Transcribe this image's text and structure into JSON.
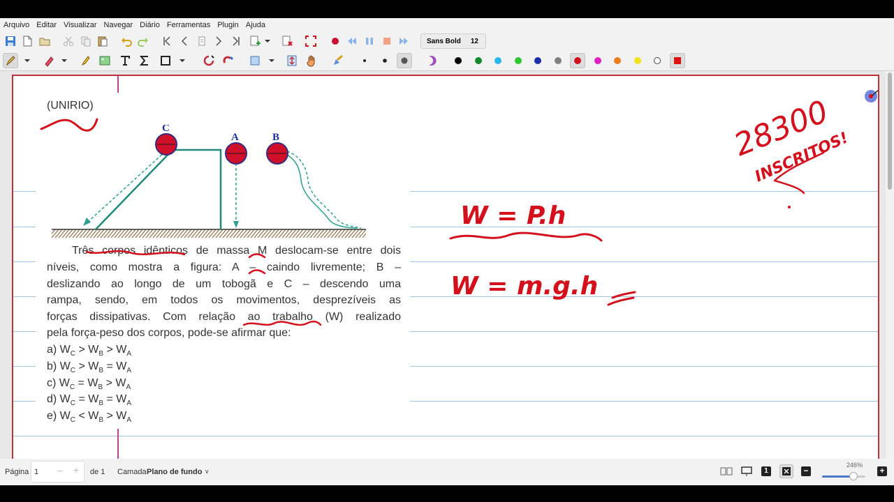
{
  "menu": [
    "Arquivo",
    "Editar",
    "Visualizar",
    "Navegar",
    "Diário",
    "Ferramentas",
    "Plugin",
    "Ajuda"
  ],
  "toolbar": {
    "font_name": "Sans Bold",
    "font_size": "12"
  },
  "pen_colors": [
    "#000000",
    "#138a2e",
    "#27b7e8",
    "#2ec52e",
    "#1a2fa8",
    "#808080",
    "#d0101e",
    "#e020c0",
    "#ee7c1c",
    "#f0e020",
    "#ffffff",
    "#e01010"
  ],
  "document": {
    "source": "(UNIRIO)",
    "labels": {
      "c": "C",
      "a": "A",
      "b": "B"
    },
    "question_lines": [
      "Três corpos idênticos de massa M deslocam-se entre dois",
      "níveis, como mostra a figura: A – caindo livremente; B –",
      "deslizando ao longo de um tobogã e C – descendo uma",
      "rampa, sendo, em todos os movimentos, desprezíveis as",
      "forças dissipativas. Com relação ao trabalho (W) realizado",
      "pela força-peso dos corpos, pode-se afirmar que:"
    ],
    "options": [
      {
        "prefix": "a)",
        "expr": [
          "C",
          " > W",
          "B",
          " > W",
          "A"
        ]
      },
      {
        "prefix": "b)",
        "expr": [
          "C",
          " > W",
          "B",
          " = W",
          "A"
        ]
      },
      {
        "prefix": "c)",
        "expr": [
          "C",
          " = W",
          "B",
          " > W",
          "A"
        ]
      },
      {
        "prefix": "d)",
        "expr": [
          "C",
          " = W",
          "B",
          " = W",
          "A"
        ]
      },
      {
        "prefix": "e)",
        "expr": [
          "C",
          " < W",
          "B",
          " > W",
          "A"
        ]
      }
    ]
  },
  "handwriting": {
    "subscribers_count": "28300",
    "subscribers_label": "INSCRITOS!",
    "formula1": "W = P.h",
    "formula2": "W = m.g.h"
  },
  "status": {
    "page_label": "Página",
    "page_value": "1",
    "page_of": "de 1",
    "layer_label": "Camada",
    "layer_value": "Plano de fundo",
    "zoom": "246%"
  }
}
